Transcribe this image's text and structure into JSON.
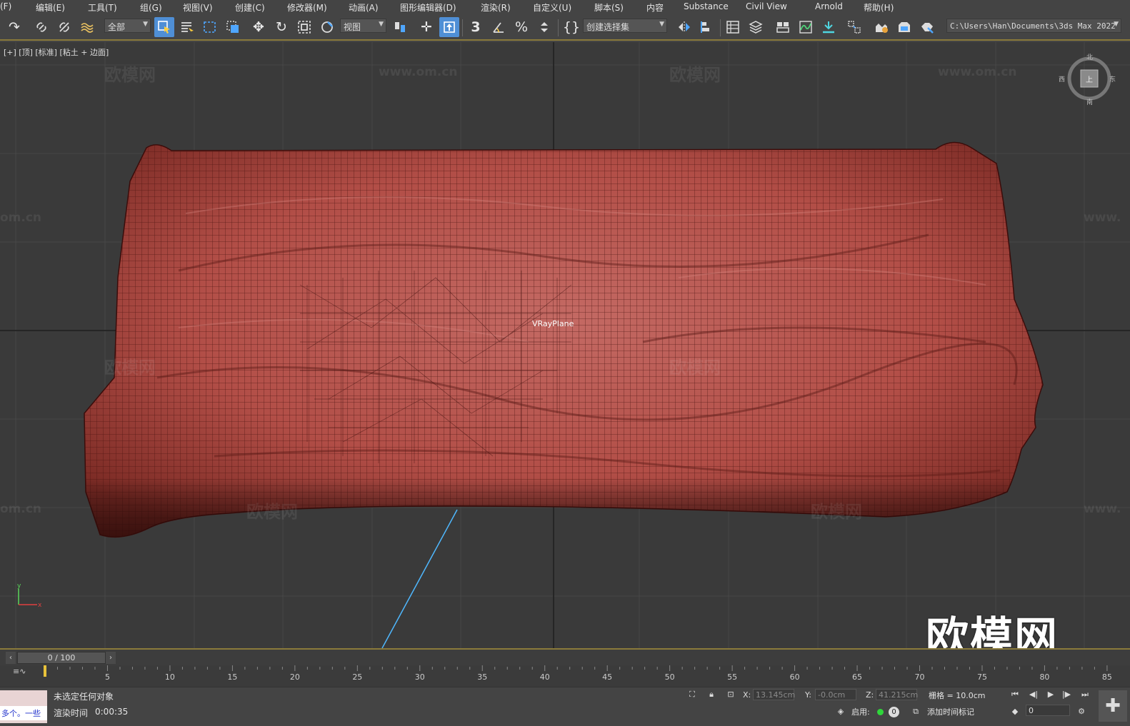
{
  "menu": {
    "items": [
      "(F)",
      "编辑(E)",
      "工具(T)",
      "组(G)",
      "视图(V)",
      "创建(C)",
      "修改器(M)",
      "动画(A)",
      "图形编辑器(D)",
      "渲染(R)",
      "自定义(U)",
      "脚本(S)",
      "内容",
      "Substance",
      "Civil View",
      "Arnold",
      "帮助(H)"
    ]
  },
  "toolbar": {
    "selection_filter": "全部",
    "ref_coord": "视图",
    "named_selection": "创建选择集",
    "project_path": "C:\\Users\\Han\\Documents\\3ds Max 2022",
    "snap_toggle": "3"
  },
  "viewport": {
    "label": "[+] [顶] [标准] [粘土 + 边面]",
    "object_label": "VRayPlane",
    "viewcube": {
      "north": "北",
      "south": "南",
      "east": "东",
      "west": "西",
      "face": "上"
    },
    "watermark_cn": "欧模网",
    "watermark_url": "www.om.cn",
    "watermark_url_cut": "om.cn",
    "watermark_url_cut_right": "www.",
    "big_logo": "欧模网"
  },
  "timeline": {
    "frame_display": "0 / 100",
    "ticks": [
      "5",
      "10",
      "15",
      "20",
      "25",
      "30",
      "35",
      "40",
      "45",
      "50",
      "55",
      "60",
      "65",
      "70",
      "75",
      "80",
      "85"
    ]
  },
  "status": {
    "maxscript_line": "多个。一些",
    "selection_status": "未选定任何对象",
    "render_time_label": "渲染时间",
    "render_time_value": "0:00:35",
    "x_label": "X:",
    "x_value": "13.145cm",
    "y_label": "Y:",
    "y_value": "-0.0cm",
    "z_label": "Z:",
    "z_value": "41.215cm",
    "grid_label": "栅格 = 10.0cm",
    "enable_label": "启用:",
    "enable_count": "0",
    "add_time_tag": "添加时间标记",
    "current_frame": "0"
  },
  "colors": {
    "accent_blue": "#4f8fd6",
    "mesh_red": "#b84a42",
    "timeline_border": "#8a7a3a"
  }
}
